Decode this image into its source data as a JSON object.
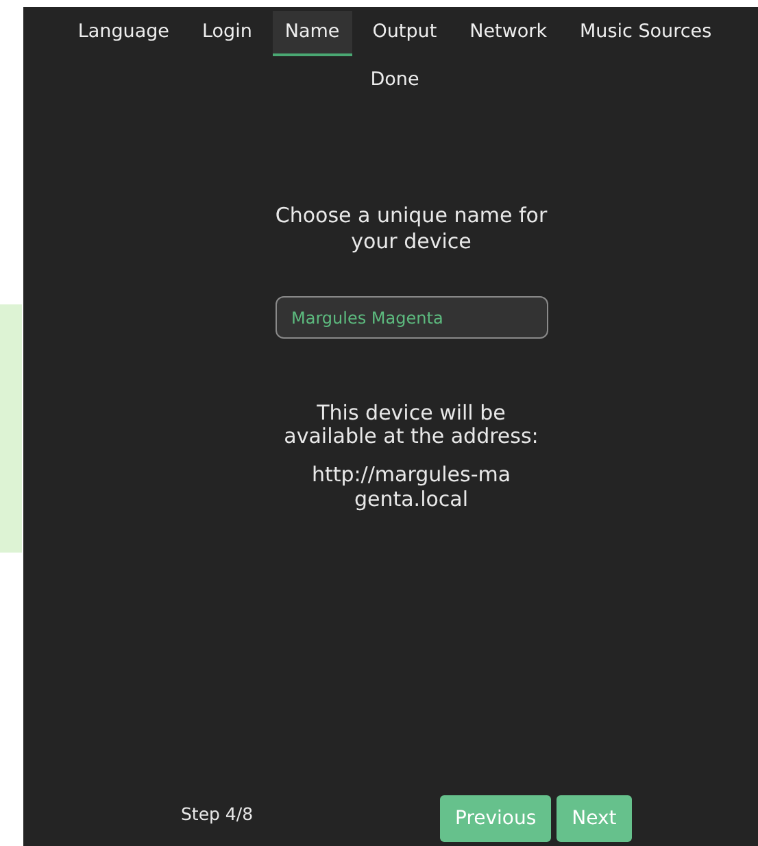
{
  "tabs": [
    {
      "label": "Language",
      "selected": false
    },
    {
      "label": "Login",
      "selected": false
    },
    {
      "label": "Name",
      "selected": true
    },
    {
      "label": "Output",
      "selected": false
    },
    {
      "label": "Network",
      "selected": false
    },
    {
      "label": "Music Sources",
      "selected": false
    },
    {
      "label": "Done",
      "selected": false
    }
  ],
  "heading": "Choose a unique name for your device",
  "name_field": {
    "value": "Margules Magenta"
  },
  "address_note": "This device will be available at the address:",
  "address": "http://margules-magenta.local",
  "step": "Step 4/8",
  "buttons": [
    "Previous",
    "Next"
  ]
}
